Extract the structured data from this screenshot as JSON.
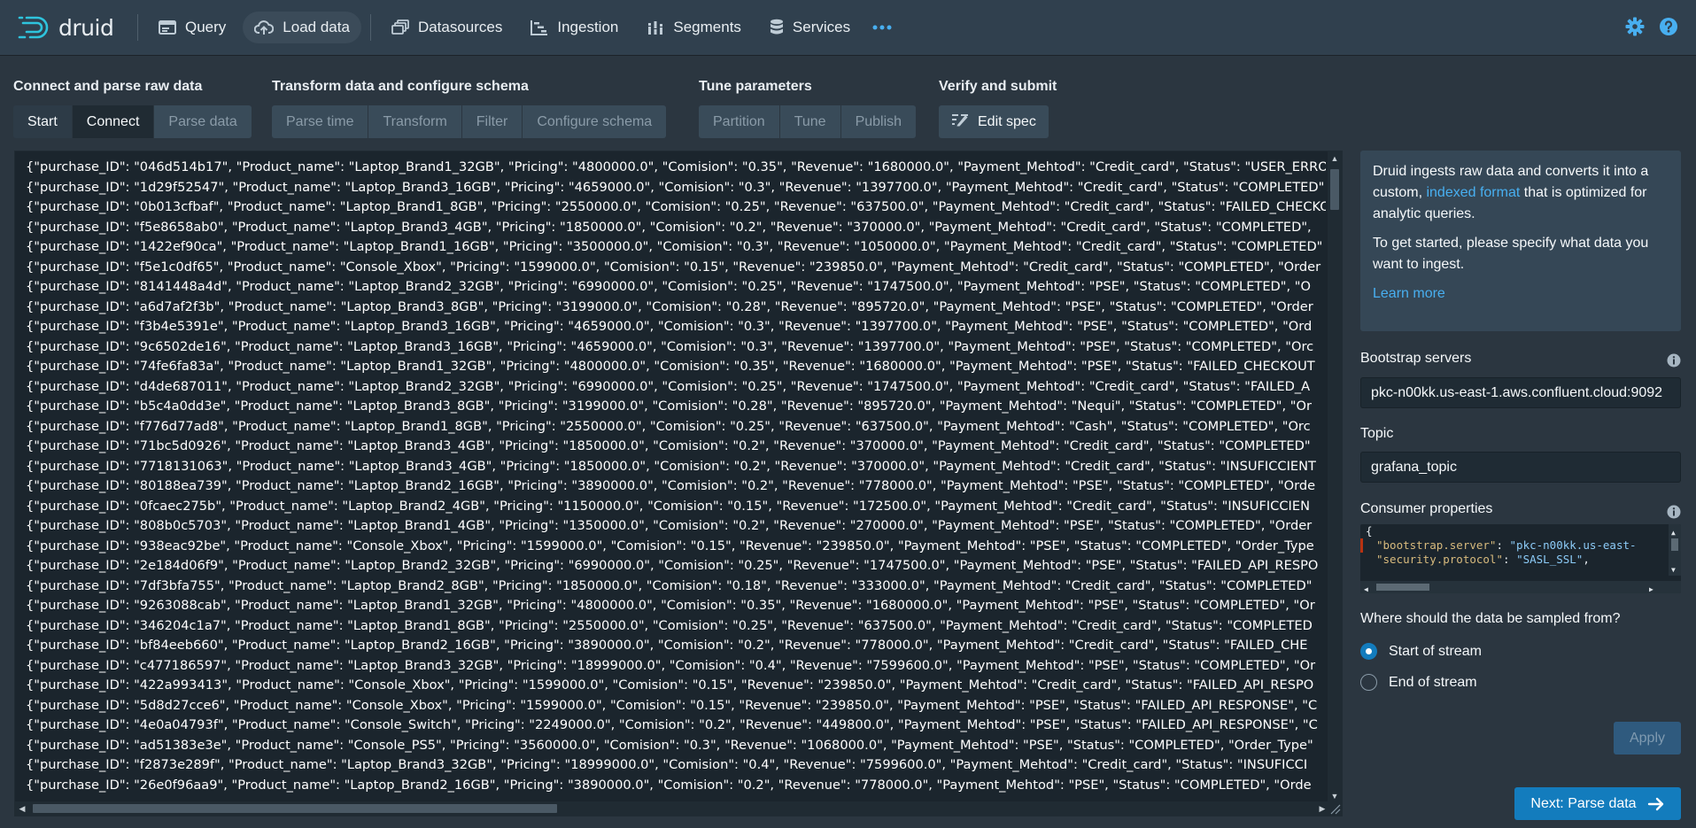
{
  "app": {
    "logo_text": "druid"
  },
  "nav": {
    "items": [
      {
        "label": "Query",
        "icon": "application-icon",
        "active": false
      },
      {
        "label": "Load data",
        "icon": "cloud-upload-icon",
        "active": true
      },
      {
        "label": "Datasources",
        "icon": "multi-select-icon",
        "active": false
      },
      {
        "label": "Ingestion",
        "icon": "gantt-chart-icon",
        "active": false
      },
      {
        "label": "Segments",
        "icon": "stacked-chart-icon",
        "active": false
      },
      {
        "label": "Services",
        "icon": "database-icon",
        "active": false
      }
    ],
    "more_icon": "more-icon",
    "settings_icon": "gear-icon",
    "help_icon": "help-icon"
  },
  "steps": {
    "connect_group": {
      "title": "Connect and parse raw data",
      "buttons": [
        "Start",
        "Connect",
        "Parse data"
      ]
    },
    "transform_group": {
      "title": "Transform data and configure schema",
      "buttons": [
        "Parse time",
        "Transform",
        "Filter",
        "Configure schema"
      ]
    },
    "tune_group": {
      "title": "Tune parameters",
      "buttons": [
        "Partition",
        "Tune",
        "Publish"
      ]
    },
    "verify_group": {
      "title": "Verify and submit",
      "edit_spec": "Edit spec"
    },
    "current_step": "Connect"
  },
  "raw_data": {
    "lines": [
      "{\"purchase_ID\": \"046d514b17\", \"Product_name\": \"Laptop_Brand1_32GB\", \"Pricing\": \"4800000.0\", \"Comision\": \"0.35\", \"Revenue\": \"1680000.0\", \"Payment_Mehtod\": \"Credit_card\", \"Status\": \"USER_ERROR\"",
      "{\"purchase_ID\": \"1d29f52547\", \"Product_name\": \"Laptop_Brand3_16GB\", \"Pricing\": \"4659000.0\", \"Comision\": \"0.3\", \"Revenue\": \"1397700.0\", \"Payment_Mehtod\": \"Credit_card\", \"Status\": \"COMPLETED\"",
      "{\"purchase_ID\": \"0b013cfbaf\", \"Product_name\": \"Laptop_Brand1_8GB\", \"Pricing\": \"2550000.0\", \"Comision\": \"0.25\", \"Revenue\": \"637500.0\", \"Payment_Mehtod\": \"Credit_card\", \"Status\": \"FAILED_CHECKOUT\"",
      "{\"purchase_ID\": \"f5e8658ab0\", \"Product_name\": \"Laptop_Brand3_4GB\", \"Pricing\": \"1850000.0\", \"Comision\": \"0.2\", \"Revenue\": \"370000.0\", \"Payment_Mehtod\": \"Credit_card\", \"Status\": \"COMPLETED\",",
      "{\"purchase_ID\": \"1422ef90ca\", \"Product_name\": \"Laptop_Brand1_16GB\", \"Pricing\": \"3500000.0\", \"Comision\": \"0.3\", \"Revenue\": \"1050000.0\", \"Payment_Mehtod\": \"Credit_card\", \"Status\": \"COMPLETED\"",
      "{\"purchase_ID\": \"f5e1c0df65\", \"Product_name\": \"Console_Xbox\", \"Pricing\": \"1599000.0\", \"Comision\": \"0.15\", \"Revenue\": \"239850.0\", \"Payment_Mehtod\": \"Credit_card\", \"Status\": \"COMPLETED\", \"Order",
      "{\"purchase_ID\": \"8141448a4d\", \"Product_name\": \"Laptop_Brand2_32GB\", \"Pricing\": \"6990000.0\", \"Comision\": \"0.25\", \"Revenue\": \"1747500.0\", \"Payment_Mehtod\": \"PSE\", \"Status\": \"COMPLETED\", \"O",
      "{\"purchase_ID\": \"a6d7af2f3b\", \"Product_name\": \"Laptop_Brand3_8GB\", \"Pricing\": \"3199000.0\", \"Comision\": \"0.28\", \"Revenue\": \"895720.0\", \"Payment_Mehtod\": \"PSE\", \"Status\": \"COMPLETED\", \"Order",
      "{\"purchase_ID\": \"f3b4e5391e\", \"Product_name\": \"Laptop_Brand3_16GB\", \"Pricing\": \"4659000.0\", \"Comision\": \"0.3\", \"Revenue\": \"1397700.0\", \"Payment_Mehtod\": \"PSE\", \"Status\": \"COMPLETED\", \"Ord",
      "{\"purchase_ID\": \"9c6502de16\", \"Product_name\": \"Laptop_Brand3_16GB\", \"Pricing\": \"4659000.0\", \"Comision\": \"0.3\", \"Revenue\": \"1397700.0\", \"Payment_Mehtod\": \"PSE\", \"Status\": \"COMPLETED\", \"Orc",
      "{\"purchase_ID\": \"74fe6fa83a\", \"Product_name\": \"Laptop_Brand1_32GB\", \"Pricing\": \"4800000.0\", \"Comision\": \"0.35\", \"Revenue\": \"1680000.0\", \"Payment_Mehtod\": \"PSE\", \"Status\": \"FAILED_CHECKOUT",
      "{\"purchase_ID\": \"d4de687011\", \"Product_name\": \"Laptop_Brand2_32GB\", \"Pricing\": \"6990000.0\", \"Comision\": \"0.25\", \"Revenue\": \"1747500.0\", \"Payment_Mehtod\": \"Credit_card\", \"Status\": \"FAILED_A",
      "{\"purchase_ID\": \"b5c4a0dd3e\", \"Product_name\": \"Laptop_Brand3_8GB\", \"Pricing\": \"3199000.0\", \"Comision\": \"0.28\", \"Revenue\": \"895720.0\", \"Payment_Mehtod\": \"Nequi\", \"Status\": \"COMPLETED\", \"Or",
      "{\"purchase_ID\": \"f776d77ad8\", \"Product_name\": \"Laptop_Brand1_8GB\", \"Pricing\": \"2550000.0\", \"Comision\": \"0.25\", \"Revenue\": \"637500.0\", \"Payment_Mehtod\": \"Cash\", \"Status\": \"COMPLETED\", \"Orc",
      "{\"purchase_ID\": \"71bc5d0926\", \"Product_name\": \"Laptop_Brand3_4GB\", \"Pricing\": \"1850000.0\", \"Comision\": \"0.2\", \"Revenue\": \"370000.0\", \"Payment_Mehtod\": \"Credit_card\", \"Status\": \"COMPLETED\"",
      "{\"purchase_ID\": \"7718131063\", \"Product_name\": \"Laptop_Brand3_4GB\", \"Pricing\": \"1850000.0\", \"Comision\": \"0.2\", \"Revenue\": \"370000.0\", \"Payment_Mehtod\": \"Credit_card\", \"Status\": \"INSUFICCIENT",
      "{\"purchase_ID\": \"80188ea739\", \"Product_name\": \"Laptop_Brand2_16GB\", \"Pricing\": \"3890000.0\", \"Comision\": \"0.2\", \"Revenue\": \"778000.0\", \"Payment_Mehtod\": \"PSE\", \"Status\": \"COMPLETED\", \"Orde",
      "{\"purchase_ID\": \"0fcaec275b\", \"Product_name\": \"Laptop_Brand2_4GB\", \"Pricing\": \"1150000.0\", \"Comision\": \"0.15\", \"Revenue\": \"172500.0\", \"Payment_Mehtod\": \"Credit_card\", \"Status\": \"INSUFICCIEN",
      "{\"purchase_ID\": \"808b0c5703\", \"Product_name\": \"Laptop_Brand1_4GB\", \"Pricing\": \"1350000.0\", \"Comision\": \"0.2\", \"Revenue\": \"270000.0\", \"Payment_Mehtod\": \"PSE\", \"Status\": \"COMPLETED\", \"Order",
      "{\"purchase_ID\": \"938eac92be\", \"Product_name\": \"Console_Xbox\", \"Pricing\": \"1599000.0\", \"Comision\": \"0.15\", \"Revenue\": \"239850.0\", \"Payment_Mehtod\": \"PSE\", \"Status\": \"COMPLETED\", \"Order_Type",
      "{\"purchase_ID\": \"2e184d06f9\", \"Product_name\": \"Laptop_Brand2_32GB\", \"Pricing\": \"6990000.0\", \"Comision\": \"0.25\", \"Revenue\": \"1747500.0\", \"Payment_Mehtod\": \"PSE\", \"Status\": \"FAILED_API_RESPO",
      "{\"purchase_ID\": \"7df3bfa755\", \"Product_name\": \"Laptop_Brand2_8GB\", \"Pricing\": \"1850000.0\", \"Comision\": \"0.18\", \"Revenue\": \"333000.0\", \"Payment_Mehtod\": \"Credit_card\", \"Status\": \"COMPLETED\"",
      "{\"purchase_ID\": \"9263088cab\", \"Product_name\": \"Laptop_Brand1_32GB\", \"Pricing\": \"4800000.0\", \"Comision\": \"0.35\", \"Revenue\": \"1680000.0\", \"Payment_Mehtod\": \"PSE\", \"Status\": \"COMPLETED\", \"Or",
      "{\"purchase_ID\": \"346204c1a7\", \"Product_name\": \"Laptop_Brand1_8GB\", \"Pricing\": \"2550000.0\", \"Comision\": \"0.25\", \"Revenue\": \"637500.0\", \"Payment_Mehtod\": \"Credit_card\", \"Status\": \"COMPLETED",
      "{\"purchase_ID\": \"bf84eeb660\", \"Product_name\": \"Laptop_Brand2_16GB\", \"Pricing\": \"3890000.0\", \"Comision\": \"0.2\", \"Revenue\": \"778000.0\", \"Payment_Mehtod\": \"Credit_card\", \"Status\": \"FAILED_CHE",
      "{\"purchase_ID\": \"c477186597\", \"Product_name\": \"Laptop_Brand3_32GB\", \"Pricing\": \"18999000.0\", \"Comision\": \"0.4\", \"Revenue\": \"7599600.0\", \"Payment_Mehtod\": \"PSE\", \"Status\": \"COMPLETED\", \"Or",
      "{\"purchase_ID\": \"422a993413\", \"Product_name\": \"Console_Xbox\", \"Pricing\": \"1599000.0\", \"Comision\": \"0.15\", \"Revenue\": \"239850.0\", \"Payment_Mehtod\": \"Credit_card\", \"Status\": \"FAILED_API_RESPO",
      "{\"purchase_ID\": \"5d8d27cce6\", \"Product_name\": \"Console_Xbox\", \"Pricing\": \"1599000.0\", \"Comision\": \"0.15\", \"Revenue\": \"239850.0\", \"Payment_Mehtod\": \"PSE\", \"Status\": \"FAILED_API_RESPONSE\", \"C",
      "{\"purchase_ID\": \"4e0a04793f\", \"Product_name\": \"Console_Switch\", \"Pricing\": \"2249000.0\", \"Comision\": \"0.2\", \"Revenue\": \"449800.0\", \"Payment_Mehtod\": \"PSE\", \"Status\": \"FAILED_API_RESPONSE\", \"C",
      "{\"purchase_ID\": \"ad51383e3e\", \"Product_name\": \"Console_PS5\", \"Pricing\": \"3560000.0\", \"Comision\": \"0.3\", \"Revenue\": \"1068000.0\", \"Payment_Mehtod\": \"PSE\", \"Status\": \"COMPLETED\", \"Order_Type\"",
      "{\"purchase_ID\": \"f2873e289f\", \"Product_name\": \"Laptop_Brand3_32GB\", \"Pricing\": \"18999000.0\", \"Comision\": \"0.4\", \"Revenue\": \"7599600.0\", \"Payment_Mehtod\": \"Credit_card\", \"Status\": \"INSUFICCI",
      "{\"purchase_ID\": \"26e0f96aa9\", \"Product_name\": \"Laptop_Brand2_16GB\", \"Pricing\": \"3890000.0\", \"Comision\": \"0.2\", \"Revenue\": \"778000.0\", \"Payment_Mehtod\": \"PSE\", \"Status\": \"COMPLETED\", \"Orde"
    ]
  },
  "panel": {
    "callout": {
      "p1_before": "Druid ingests raw data and converts it into a custom, ",
      "p1_link": "indexed format",
      "p1_after": " that is optimized for analytic queries.",
      "p2": "To get started, please specify what data you want to ingest.",
      "learn_more": "Learn more"
    },
    "bootstrap": {
      "label": "Bootstrap servers",
      "value": "pkc-n00kk.us-east-1.aws.confluent.cloud:9092"
    },
    "topic": {
      "label": "Topic",
      "value": "grafana_topic"
    },
    "consumer": {
      "label": "Consumer properties",
      "line1": "{",
      "line2_key": "\"bootstrap.server\"",
      "line2_val": "\"pkc-n00kk.us-east-",
      "line3_key": "\"security.protocol\"",
      "line3_val": "\"SASL_SSL\"",
      "line3_end": ","
    },
    "sample": {
      "label": "Where should the data be sampled from?",
      "options": [
        "Start of stream",
        "End of stream"
      ],
      "selected": "Start of stream"
    },
    "apply_label": "Apply",
    "next_label": "Next: Parse data"
  }
}
